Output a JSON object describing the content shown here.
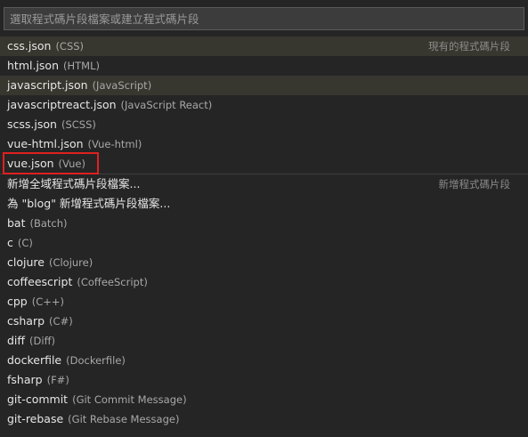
{
  "search": {
    "placeholder": "選取程式碼片段檔案或建立程式碼片段"
  },
  "groups": {
    "existing": "現有的程式碼片段",
    "new": "新增程式碼片段"
  },
  "existing_items": [
    {
      "name": "css.json",
      "lang": "(CSS)"
    },
    {
      "name": "html.json",
      "lang": "(HTML)"
    },
    {
      "name": "javascript.json",
      "lang": "(JavaScript)"
    },
    {
      "name": "javascriptreact.json",
      "lang": "(JavaScript React)"
    },
    {
      "name": "scss.json",
      "lang": "(SCSS)"
    },
    {
      "name": "vue-html.json",
      "lang": "(Vue-html)"
    },
    {
      "name": "vue.json",
      "lang": "(Vue)"
    }
  ],
  "new_items": [
    {
      "name": "新增全域程式碼片段檔案...",
      "lang": ""
    },
    {
      "name": "為 \"blog\" 新增程式碼片段檔案...",
      "lang": ""
    },
    {
      "name": "bat",
      "lang": "(Batch)"
    },
    {
      "name": "c",
      "lang": "(C)"
    },
    {
      "name": "clojure",
      "lang": "(Clojure)"
    },
    {
      "name": "coffeescript",
      "lang": "(CoffeeScript)"
    },
    {
      "name": "cpp",
      "lang": "(C++)"
    },
    {
      "name": "csharp",
      "lang": "(C#)"
    },
    {
      "name": "diff",
      "lang": "(Diff)"
    },
    {
      "name": "dockerfile",
      "lang": "(Dockerfile)"
    },
    {
      "name": "fsharp",
      "lang": "(F#)"
    },
    {
      "name": "git-commit",
      "lang": "(Git Commit Message)"
    },
    {
      "name": "git-rebase",
      "lang": "(Git Rebase Message)"
    }
  ],
  "colors": {
    "background": "#252526",
    "highlight": "#37372f",
    "annotation": "#e02020"
  }
}
